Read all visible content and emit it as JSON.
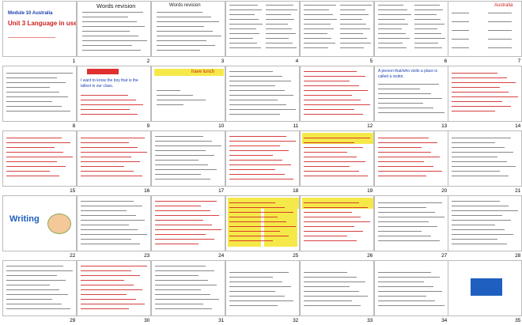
{
  "slides": [
    {
      "num": "1",
      "title": "Module 10 Australia",
      "subtitle": "Unit 3 Language in use",
      "caption": ""
    },
    {
      "num": "2",
      "title": "Words revision",
      "subtitle": "",
      "caption": ""
    },
    {
      "num": "3",
      "title": "Words revision",
      "subtitle": "",
      "caption": ""
    },
    {
      "num": "4",
      "title": "",
      "subtitle": "",
      "caption": ""
    },
    {
      "num": "5",
      "title": "",
      "subtitle": "",
      "caption": ""
    },
    {
      "num": "6",
      "title": "",
      "subtitle": "",
      "caption": ""
    },
    {
      "num": "7",
      "title": "Australia",
      "subtitle": "",
      "caption": ""
    },
    {
      "num": "8",
      "title": "",
      "subtitle": "",
      "caption": ""
    },
    {
      "num": "9",
      "title": "",
      "subtitle": "",
      "caption": "I want to know the boy that is the tallest in our class."
    },
    {
      "num": "10",
      "title": "",
      "subtitle": "",
      "caption": "have lunch"
    },
    {
      "num": "11",
      "title": "",
      "subtitle": "",
      "caption": ""
    },
    {
      "num": "12",
      "title": "",
      "subtitle": "",
      "caption": ""
    },
    {
      "num": "13",
      "title": "",
      "subtitle": "",
      "caption": "A person that/who visits a place is called a visitor."
    },
    {
      "num": "14",
      "title": "",
      "subtitle": "",
      "caption": ""
    },
    {
      "num": "15",
      "title": "",
      "subtitle": "",
      "caption": ""
    },
    {
      "num": "16",
      "title": "",
      "subtitle": "",
      "caption": ""
    },
    {
      "num": "17",
      "title": "",
      "subtitle": "",
      "caption": ""
    },
    {
      "num": "18",
      "title": "",
      "subtitle": "",
      "caption": ""
    },
    {
      "num": "19",
      "title": "",
      "subtitle": "",
      "caption": ""
    },
    {
      "num": "20",
      "title": "",
      "subtitle": "",
      "caption": ""
    },
    {
      "num": "21",
      "title": "",
      "subtitle": "",
      "caption": ""
    },
    {
      "num": "22",
      "title": "Writing",
      "subtitle": "",
      "caption": ""
    },
    {
      "num": "23",
      "title": "",
      "subtitle": "",
      "caption": ""
    },
    {
      "num": "24",
      "title": "",
      "subtitle": "",
      "caption": ""
    },
    {
      "num": "25",
      "title": "",
      "subtitle": "",
      "caption": ""
    },
    {
      "num": "26",
      "title": "",
      "subtitle": "",
      "caption": ""
    },
    {
      "num": "27",
      "title": "",
      "subtitle": "",
      "caption": ""
    },
    {
      "num": "28",
      "title": "",
      "subtitle": "",
      "caption": ""
    },
    {
      "num": "29",
      "title": "",
      "subtitle": "",
      "caption": ""
    },
    {
      "num": "30",
      "title": "",
      "subtitle": "",
      "caption": ""
    },
    {
      "num": "31",
      "title": "",
      "subtitle": "",
      "caption": ""
    },
    {
      "num": "32",
      "title": "",
      "subtitle": "",
      "caption": ""
    },
    {
      "num": "33",
      "title": "",
      "subtitle": "",
      "caption": ""
    },
    {
      "num": "34",
      "title": "",
      "subtitle": "",
      "caption": ""
    },
    {
      "num": "35",
      "title": "",
      "subtitle": "",
      "caption": ""
    }
  ],
  "colors": {
    "accent_red": "#d02020",
    "accent_blue": "#1a3fae",
    "yellow": "#f5e94a",
    "green": "#2a8a2a",
    "logo_blue": "#1f5fbf"
  }
}
